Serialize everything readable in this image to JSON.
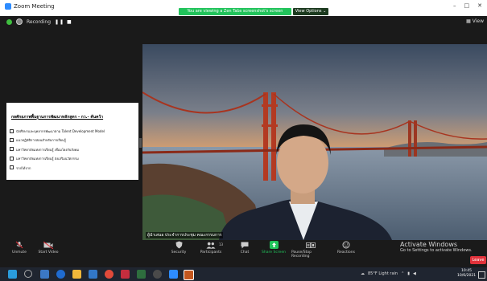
{
  "window": {
    "title": "Zoom Meeting",
    "controls": [
      "–",
      "□",
      "✕"
    ]
  },
  "share_banner": "You are viewing a Zen Tabs screenshot's screen",
  "view_options": "View Options ⌄",
  "status": {
    "recording": "Recording",
    "view_label": "View"
  },
  "slide": {
    "title": "กลศักยภาพพื้นฐานการพัฒนาหลักสูตร - กว.- ค้นคว้า",
    "items": [
      "นักศึกษาและบุคลากรพัฒนาตาม Talent Development Model",
      "แนวปฏิบัติการสอนสำหรับการเรียนรู้",
      "มหาวิทยาลัยแห่งการเรียนรู้ เชื่อมโยงกับสังคม",
      "มหาวิทยาลัยแห่งการเรียนรู้ ส่งเสริมนวัตกรรม",
      "รายได้จาก"
    ]
  },
  "video": {
    "name_badge": "ผู้นำเสนอ ประจำการประชุม คณะกรรมการ"
  },
  "watermark": {
    "line1": "Activate Windows",
    "line2": "Go to Settings to activate Windows."
  },
  "toolbar": {
    "unmute": "Unmute",
    "start_video": "Start Video",
    "security": "Security",
    "participants": "Participants",
    "participants_count": "13",
    "chat": "Chat",
    "share_screen": "Share Screen",
    "pause_recording": "Pause/Stop Recording",
    "reactions": "Reactions",
    "leave": "Leave"
  },
  "taskbar": {
    "weather": "85°F Light rain",
    "time": "10:45",
    "date": "10/6/2021"
  }
}
